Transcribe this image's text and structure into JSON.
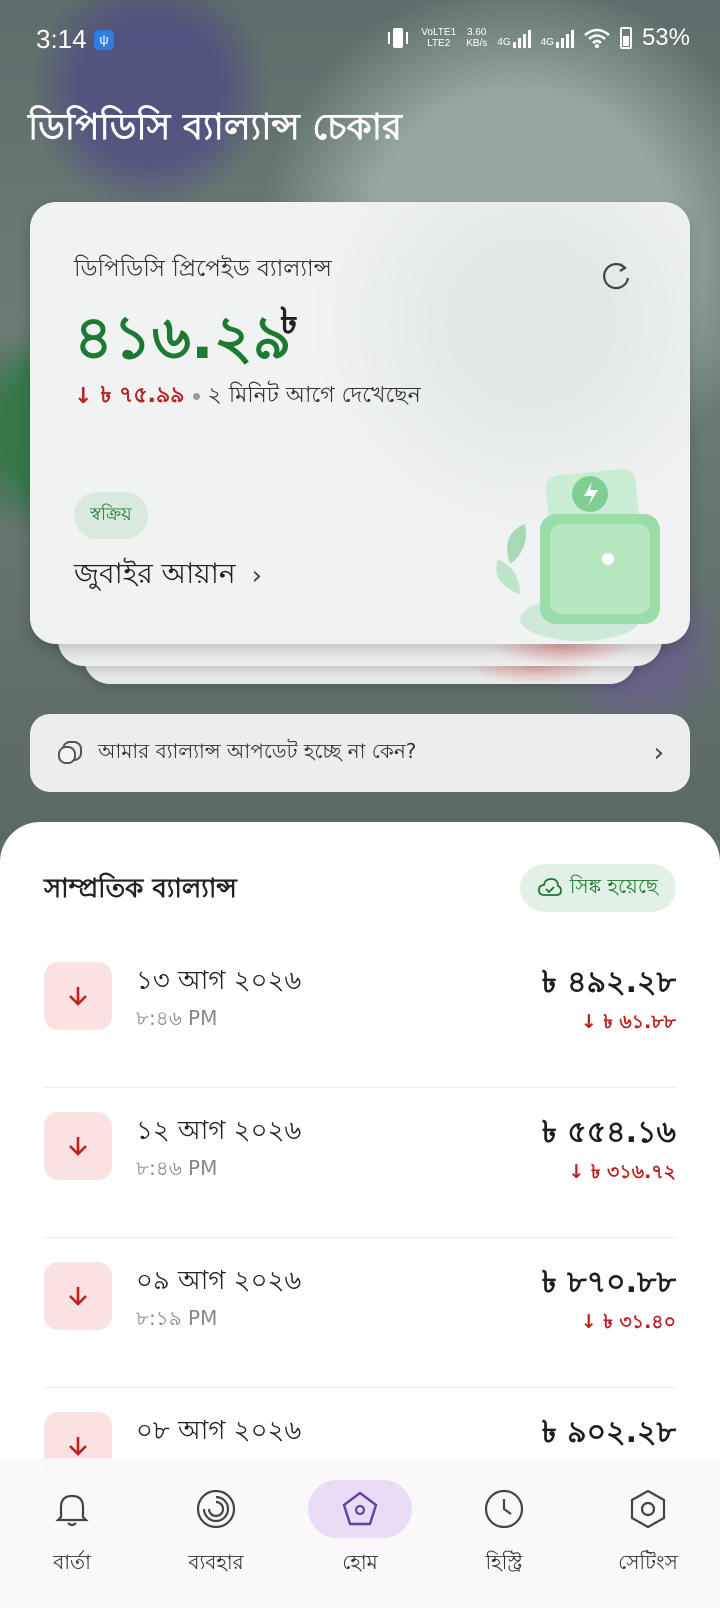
{
  "status_bar": {
    "time": "3:14",
    "network_top": "VoLTE1",
    "network_bottom": "LTE2",
    "speed_value": "3.60",
    "speed_unit": "KB/s",
    "net1": "4G",
    "net2": "4G",
    "battery": "53%"
  },
  "app": {
    "title": "ডিপিডিসি ব্যাল্যান্স চেকার"
  },
  "balance_card": {
    "label": "ডিপিডিসি প্রিপেইড ব্যাল্যান্স",
    "amount": "৪১৬.২৯",
    "currency": "৳",
    "change": "৳ ৭৫.৯৯",
    "last_seen": "২ মিনিট আগে দেখেছেন",
    "status": "স্বক্রিয়",
    "account_name": "জুবাইর আয়ান"
  },
  "info_bar": {
    "label": "আমার ব্যাল্যান্স আপডেট হচ্ছে না কেন?"
  },
  "recent": {
    "title": "সাম্প্রতিক ব্যাল্যান্স",
    "sync_label": "সিঙ্ক হয়েছে",
    "rows": [
      {
        "date": "১৩ আগ ২০২৬",
        "time": "৮:৪৬ PM",
        "amount": "৳ ৪৯২.২৮",
        "change": "৳ ৬১.৮৮"
      },
      {
        "date": "১২ আগ ২০২৬",
        "time": "৮:৪৬ PM",
        "amount": "৳ ৫৫৪.১৬",
        "change": "৳ ৩১৬.৭২"
      },
      {
        "date": "০৯ আগ ২০২৬",
        "time": "৮:১৯ PM",
        "amount": "৳ ৮৭০.৮৮",
        "change": "৳ ৩১.৪০"
      },
      {
        "date": "০৮ আগ ২০২৬",
        "time": "",
        "amount": "৳ ৯০২.২৮",
        "change": ""
      }
    ]
  },
  "nav": {
    "items": [
      {
        "label": "বার্তা",
        "icon": "bell-icon"
      },
      {
        "label": "ব্যবহার",
        "icon": "usage-ring-icon"
      },
      {
        "label": "হোম",
        "icon": "home-pentagon-icon"
      },
      {
        "label": "হিস্ট্রি",
        "icon": "clock-icon"
      },
      {
        "label": "সেটিংস",
        "icon": "settings-hexagon-icon"
      }
    ],
    "active_index": 2
  },
  "colors": {
    "accent_green": "#1c7a33",
    "down_red": "#b42321",
    "nav_active": "#e9dcf5"
  }
}
